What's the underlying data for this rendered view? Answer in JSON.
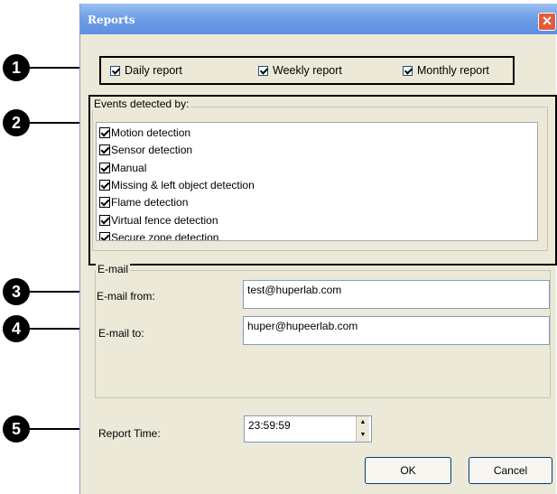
{
  "window": {
    "title": "Reports",
    "close_symbol": "✕"
  },
  "report_types": [
    {
      "label": "Daily report",
      "checked": true
    },
    {
      "label": "Weekly report",
      "checked": true
    },
    {
      "label": "Monthly report",
      "checked": true
    }
  ],
  "events": {
    "group_label": "Events detected by:",
    "items": [
      {
        "label": "Motion detection",
        "checked": true
      },
      {
        "label": "Sensor detection",
        "checked": true
      },
      {
        "label": "Manual",
        "checked": true
      },
      {
        "label": "Missing & left object detection",
        "checked": true
      },
      {
        "label": "Flame detection",
        "checked": true
      },
      {
        "label": "Virtual fence detection",
        "checked": true
      },
      {
        "label": "Secure zone detection",
        "checked": true
      }
    ]
  },
  "email": {
    "group_label": "E-mail",
    "from_label": "E-mail from:",
    "from_value": "test@huperlab.com",
    "to_label": "E-mail to:",
    "to_value": "huper@hupeerlab.com"
  },
  "report_time": {
    "label": "Report Time:",
    "value": "23:59:59",
    "up": "▲",
    "down": "▼"
  },
  "buttons": {
    "ok": "OK",
    "cancel": "Cancel"
  },
  "callouts": [
    "1",
    "2",
    "3",
    "4",
    "5"
  ]
}
